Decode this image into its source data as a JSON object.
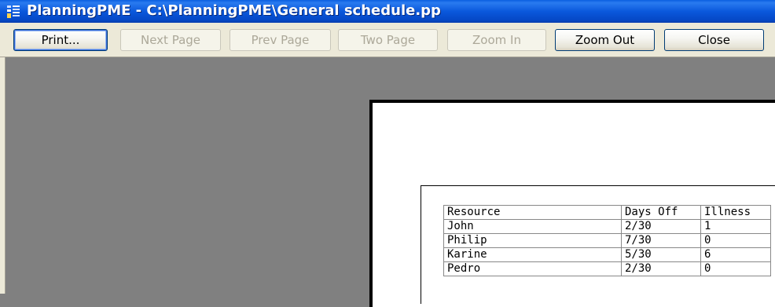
{
  "window": {
    "title": "PlanningPME - C:\\PlanningPME\\General schedule.pp",
    "icon": "app-icon"
  },
  "toolbar": {
    "print": "Print...",
    "next_page": "Next Page",
    "prev_page": "Prev Page",
    "two_page": "Two Page",
    "zoom_in": "Zoom In",
    "zoom_out": "Zoom Out",
    "close": "Close"
  },
  "report": {
    "headers": [
      "Resource",
      "Days Off",
      "Illness"
    ],
    "rows": [
      [
        "John",
        "2/30",
        "1"
      ],
      [
        "Philip",
        "7/30",
        "0"
      ],
      [
        "Karine",
        "5/30",
        "6"
      ],
      [
        "Pedro",
        "2/30",
        "0"
      ]
    ]
  },
  "colors": {
    "titlebar": "#0a58dc",
    "toolbar": "#ece9d8",
    "workspace": "#808080",
    "page": "#ffffff"
  }
}
